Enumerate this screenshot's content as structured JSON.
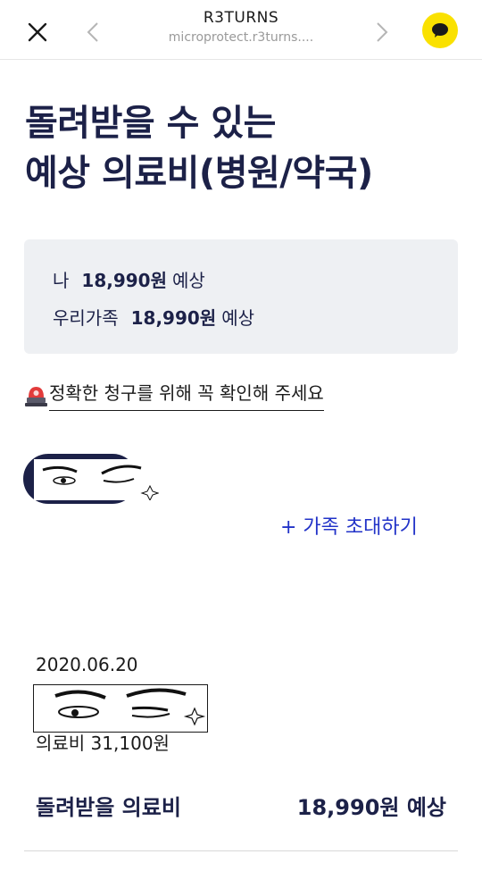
{
  "topbar": {
    "title": "R3TURNS",
    "url": "microprotect.r3turns...."
  },
  "page": {
    "title_line1": "돌려받을 수 있는",
    "title_line2": "예상 의료비(병원/약국)"
  },
  "summary": {
    "me_label": "나",
    "me_amount": "18,990원",
    "me_suffix": "예상",
    "family_label": "우리가족",
    "family_amount": "18,990원",
    "family_suffix": "예상"
  },
  "notice": {
    "text": "정확한 청구를 위해 꼭 확인해 주세요"
  },
  "invite": {
    "label": "+ 가족 초대하기"
  },
  "history": {
    "date": "2020.06.20",
    "fee": "의료비 31,100원",
    "refund_label": "돌려받을 의료비",
    "refund_value": "18,990원 예상"
  },
  "colors": {
    "navy": "#1c2148",
    "link_blue": "#2233c8",
    "card_bg": "#eef0f3",
    "kakao_yellow": "#fae100"
  }
}
